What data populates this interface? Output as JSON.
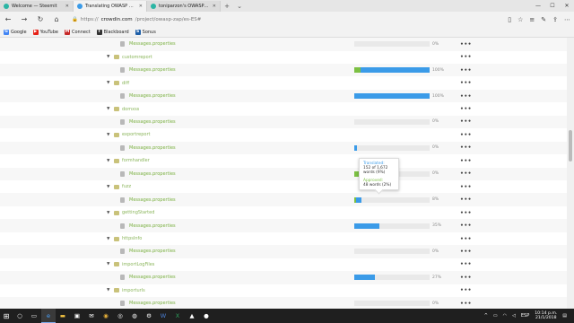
{
  "tabs": [
    {
      "title": "Welcome — Steemit",
      "color": "#2bb5a4",
      "active": false
    },
    {
      "title": "Translating OWASP ZAP",
      "color": "#3b9be8",
      "active": true
    },
    {
      "title": "toniparzon's OWASP ZAP Tr",
      "color": "#2bb5a4",
      "active": false
    }
  ],
  "address": {
    "prefix": "https://",
    "host": "crowdin.com",
    "path": "/project/owasp-zap/es-ES#"
  },
  "bookmarks": [
    {
      "label": "Google",
      "icon": "google-icon",
      "color": "#4285f4",
      "glyph": "G"
    },
    {
      "label": "YouTube",
      "icon": "youtube-icon",
      "color": "#e62117",
      "glyph": "▶"
    },
    {
      "label": "Connect",
      "icon": "connect-icon",
      "color": "#c62828",
      "glyph": "M"
    },
    {
      "label": "Blackboard",
      "icon": "blackboard-icon",
      "color": "#333333",
      "glyph": "T"
    },
    {
      "label": "Sonus",
      "icon": "sonus-icon",
      "color": "#1e5fa8",
      "glyph": "S"
    }
  ],
  "rows": [
    {
      "type": "file",
      "name": "Messages.properties",
      "translated": 0,
      "approved": 0,
      "pct": "0%"
    },
    {
      "type": "folder",
      "name": "customreport"
    },
    {
      "type": "file",
      "name": "Messages.properties",
      "translated": 100,
      "approved": 8,
      "pct": "100%"
    },
    {
      "type": "folder",
      "name": "diff"
    },
    {
      "type": "file",
      "name": "Messages.properties",
      "translated": 100,
      "approved": 0,
      "pct": "100%"
    },
    {
      "type": "folder",
      "name": "domxss"
    },
    {
      "type": "file",
      "name": "Messages.properties",
      "translated": 0,
      "approved": 0,
      "pct": "0%"
    },
    {
      "type": "folder",
      "name": "exportreport"
    },
    {
      "type": "file",
      "name": "Messages.properties",
      "translated": 4,
      "approved": 0,
      "pct": "0%"
    },
    {
      "type": "folder",
      "name": "formhandler"
    },
    {
      "type": "file",
      "name": "Messages.properties",
      "translated": 9,
      "approved": 8,
      "pct": "0%"
    },
    {
      "type": "folder",
      "name": "fuzz"
    },
    {
      "type": "file",
      "name": "Messages.properties",
      "translated": 9,
      "approved": 2,
      "pct": "8%"
    },
    {
      "type": "folder",
      "name": "gettingStarted"
    },
    {
      "type": "file",
      "name": "Messages.properties",
      "translated": 33,
      "approved": 0,
      "pct": "35%"
    },
    {
      "type": "folder",
      "name": "httpsInfo"
    },
    {
      "type": "file",
      "name": "Messages.properties",
      "translated": 0,
      "approved": 0,
      "pct": "0%"
    },
    {
      "type": "folder",
      "name": "importLogFiles"
    },
    {
      "type": "file",
      "name": "Messages.properties",
      "translated": 27,
      "approved": 0,
      "pct": "27%"
    },
    {
      "type": "folder",
      "name": "importurls"
    },
    {
      "type": "file",
      "name": "Messages.properties",
      "translated": 0,
      "approved": 0,
      "pct": "0%"
    }
  ],
  "tooltip": {
    "translated_label": "Translated:",
    "translated_value": "152 of 1,672 words (9%)",
    "approved_label": "Approved:",
    "approved_value": "48 words (2%)"
  },
  "taskbar": {
    "time": "10:14 p.m.",
    "date": "21/1/2018",
    "lang": "ESP"
  },
  "colors": {
    "translated": "#3b9be8",
    "approved": "#7cc043"
  }
}
